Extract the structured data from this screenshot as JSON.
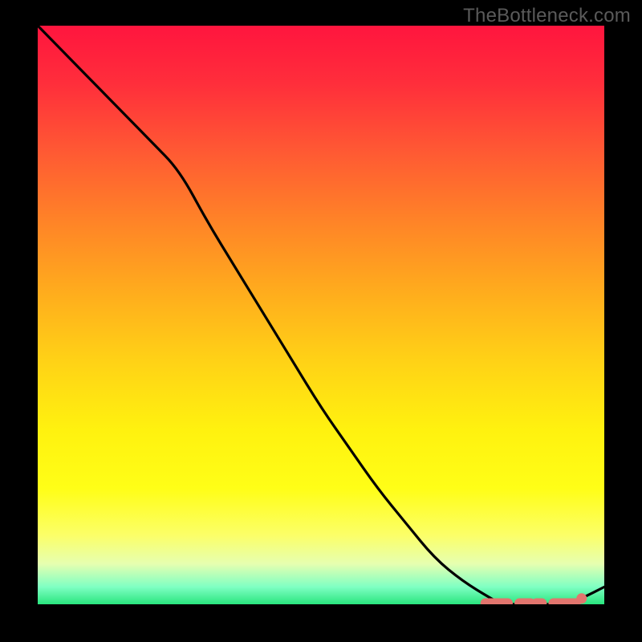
{
  "watermark": "TheBottleneck.com",
  "colors": {
    "background": "#000000",
    "curve_stroke": "#000000",
    "highlight_stroke": "#e2756e",
    "highlight_dot": "#e2756e"
  },
  "chart_data": {
    "type": "line",
    "title": "",
    "xlabel": "",
    "ylabel": "",
    "xlim": [
      0,
      100
    ],
    "ylim": [
      0,
      100
    ],
    "x": [
      0,
      5,
      10,
      15,
      20,
      25,
      30,
      35,
      40,
      45,
      50,
      55,
      60,
      65,
      70,
      75,
      80,
      82,
      85,
      88,
      90,
      93,
      96,
      100
    ],
    "y": [
      100,
      95,
      90,
      85,
      80,
      75,
      66,
      58,
      50,
      42,
      34,
      27,
      20,
      14,
      8,
      4,
      1,
      0,
      0,
      0,
      0,
      0,
      1,
      3
    ],
    "highlight_segments": [
      {
        "x1": 79,
        "x2": 83
      },
      {
        "x1": 85,
        "x2": 87
      },
      {
        "x1": 88,
        "x2": 89
      },
      {
        "x1": 91,
        "x2": 95
      }
    ],
    "highlight_dot": {
      "x": 96,
      "y": 1
    }
  }
}
